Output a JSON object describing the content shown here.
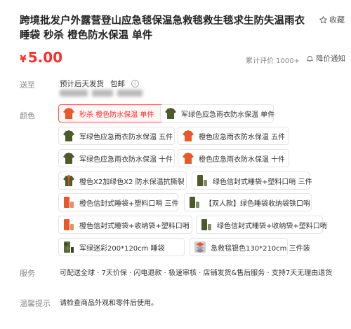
{
  "product": {
    "title": "跨境批发户外露营登山应急毯保温急救毯救生毯求生防失温雨衣睡袋 秒杀 橙色防水保温 单件",
    "favorite_label": "收藏"
  },
  "price": {
    "currency": "¥",
    "amount": "5.00",
    "reviews": "累计评价 1000+",
    "notify_label": "降价通知"
  },
  "shipping": {
    "label": "送至",
    "eta": "预计后天发货",
    "free_shipping": "包邮"
  },
  "color": {
    "label": "颜色",
    "options": [
      {
        "label": "秒杀 橙色防水保温 单件",
        "selected": true,
        "thumb": "orange-raincoat"
      },
      {
        "label": "军绿色应急雨衣防水保温 单件",
        "selected": false,
        "thumb": "green-raincoat"
      },
      {
        "label": "军绿色应急雨衣防水保温 五件",
        "selected": false,
        "thumb": "green-raincoat"
      },
      {
        "label": "橙色应急雨衣防水保温 五件",
        "selected": false,
        "thumb": "orange-raincoat"
      },
      {
        "label": "军绿色应急雨衣防水保温 十件",
        "selected": false,
        "thumb": "green-raincoat"
      },
      {
        "label": "橙色应急雨衣防水保温 十件",
        "selected": false,
        "thumb": "orange-raincoat"
      },
      {
        "label": "橙色X2加绿色X2 防水保温抗撕裂",
        "selected": false,
        "thumb": "mixed-raincoat"
      },
      {
        "label": "绿色信封式睡袋+塑料口哨 三件",
        "selected": false,
        "thumb": "green-sleeping-bag"
      },
      {
        "label": "橙色信封式睡袋+塑料口哨 三件",
        "selected": false,
        "thumb": "orange-sleeping-bag"
      },
      {
        "label": "【双人款】绿色睡袋收纳袋铁口哨",
        "selected": false,
        "thumb": "green-sleeping-bag"
      },
      {
        "label": "橙色信封式睡袋+收纳袋+塑料口哨",
        "selected": false,
        "thumb": "orange-sleeping-bag"
      },
      {
        "label": "绿色信封式睡袋+收纳袋+塑料口哨",
        "selected": false,
        "thumb": "green-sleeping-bag"
      },
      {
        "label": "军绿迷彩200*120cm 睡袋",
        "selected": false,
        "thumb": "camo-sleeping-bag"
      },
      {
        "label": "急救毯银色130*210cm 三件装",
        "selected": false,
        "thumb": "silver-blanket"
      }
    ]
  },
  "services": {
    "label": "服务",
    "text": "可配送全球 · 7天价保 · 闪电退款 · 极速审核 · 店铺发货&售后服务 · 支持7天无理由退货"
  },
  "tips": {
    "label": "温馨提示",
    "text": "请检查商品外观和零件后使用。"
  },
  "colors": {
    "price_red": "#ff2d2d",
    "selected_border": "#ff5050",
    "orange_thumb": "#e8582a",
    "green_thumb": "#4e5a2b"
  }
}
